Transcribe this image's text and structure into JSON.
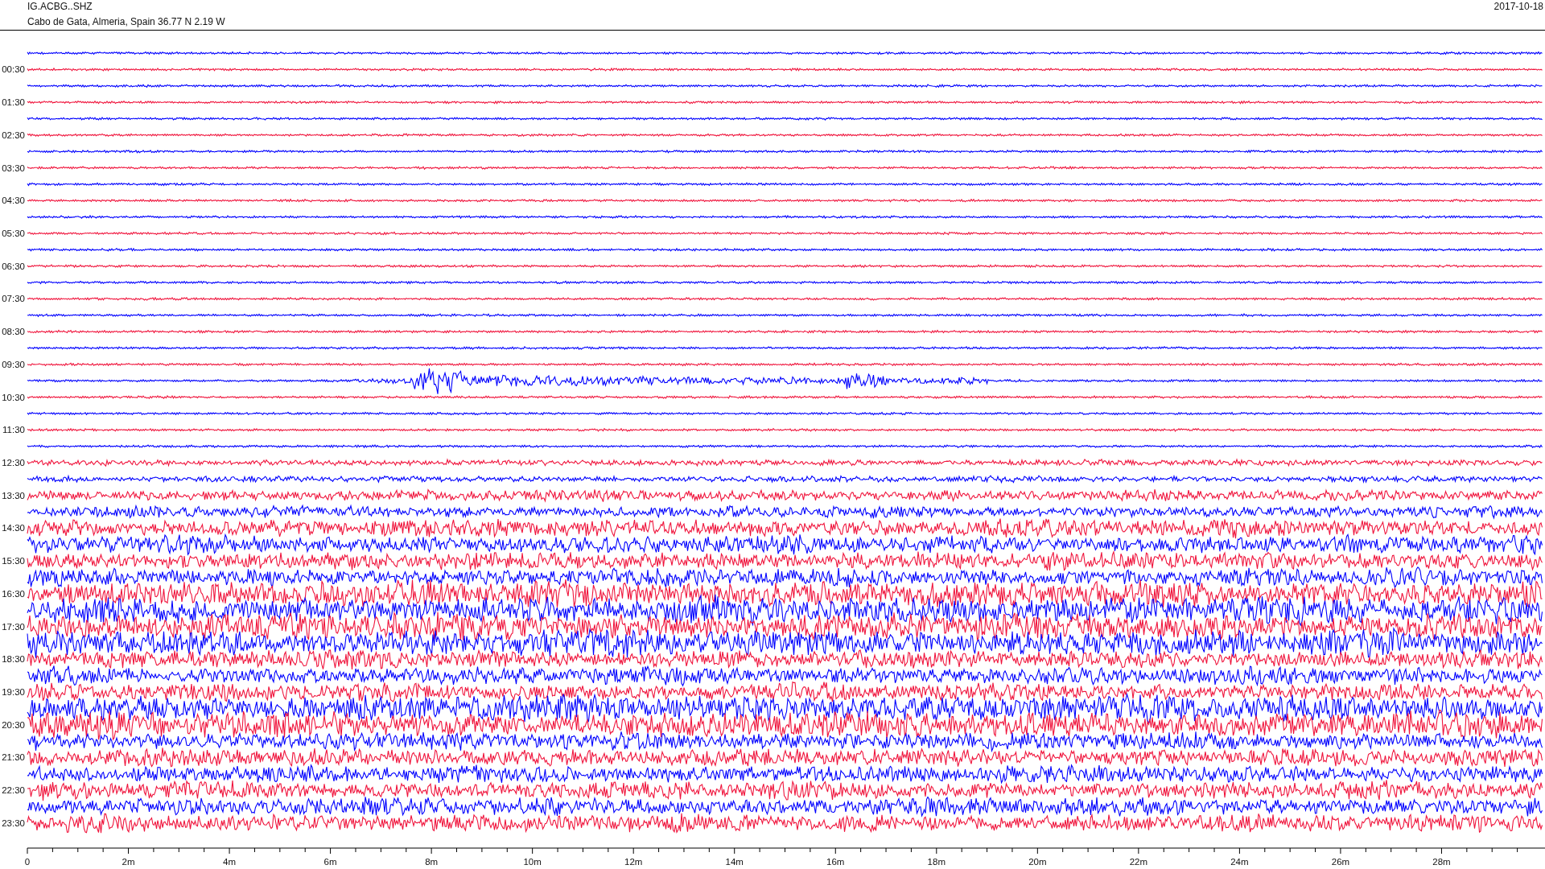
{
  "header": {
    "station": "IG.ACBG..SHZ",
    "location": "Cabo de Gata, Almeria, Spain  36.77 N 2.19 W",
    "date": "2017-10-18"
  },
  "traces": [
    {
      "color": "#0000ff",
      "kind": "quiet"
    },
    {
      "color": "#f0143c",
      "kind": "quiet",
      "label": "00:30"
    },
    {
      "color": "#0000ff",
      "kind": "quiet"
    },
    {
      "color": "#f0143c",
      "kind": "quiet",
      "label": "01:30"
    },
    {
      "color": "#0000ff",
      "kind": "quiet"
    },
    {
      "color": "#f0143c",
      "kind": "quiet",
      "label": "02:30"
    },
    {
      "color": "#0000ff",
      "kind": "quiet"
    },
    {
      "color": "#f0143c",
      "kind": "quiet",
      "label": "03:30"
    },
    {
      "color": "#0000ff",
      "kind": "quiet"
    },
    {
      "color": "#f0143c",
      "kind": "quiet",
      "label": "04:30"
    },
    {
      "color": "#0000ff",
      "kind": "quiet"
    },
    {
      "color": "#f0143c",
      "kind": "quiet",
      "label": "05:30"
    },
    {
      "color": "#0000ff",
      "kind": "quiet"
    },
    {
      "color": "#f0143c",
      "kind": "quiet",
      "label": "06:30"
    },
    {
      "color": "#0000ff",
      "kind": "quiet"
    },
    {
      "color": "#f0143c",
      "kind": "quiet",
      "label": "07:30"
    },
    {
      "color": "#0000ff",
      "kind": "quiet"
    },
    {
      "color": "#f0143c",
      "kind": "quiet",
      "label": "08:30"
    },
    {
      "color": "#0000ff",
      "kind": "quiet"
    },
    {
      "color": "#f0143c",
      "kind": "quiet",
      "label": "09:30"
    },
    {
      "color": "#0000ff",
      "kind": "event"
    },
    {
      "color": "#f0143c",
      "kind": "quiet",
      "label": "10:30"
    },
    {
      "color": "#0000ff",
      "kind": "quiet"
    },
    {
      "color": "#f0143c",
      "kind": "quiet",
      "label": "11:30"
    },
    {
      "color": "#0000ff",
      "kind": "quiet"
    },
    {
      "color": "#f0143c",
      "kind": "light",
      "label": "12:30"
    },
    {
      "color": "#0000ff",
      "kind": "light"
    },
    {
      "color": "#f0143c",
      "kind": "moderate",
      "label": "13:30"
    },
    {
      "color": "#0000ff",
      "kind": "moderate"
    },
    {
      "color": "#f0143c",
      "kind": "strong",
      "label": "14:30"
    },
    {
      "color": "#0000ff",
      "kind": "strong"
    },
    {
      "color": "#f0143c",
      "kind": "strong",
      "label": "15:30"
    },
    {
      "color": "#0000ff",
      "kind": "strong"
    },
    {
      "color": "#f0143c",
      "kind": "intense",
      "label": "16:30"
    },
    {
      "color": "#0000ff",
      "kind": "intense"
    },
    {
      "color": "#f0143c",
      "kind": "intense",
      "label": "17:30"
    },
    {
      "color": "#0000ff",
      "kind": "intense"
    },
    {
      "color": "#f0143c",
      "kind": "strong",
      "label": "18:30"
    },
    {
      "color": "#0000ff",
      "kind": "strong"
    },
    {
      "color": "#f0143c",
      "kind": "strong",
      "label": "19:30"
    },
    {
      "color": "#0000ff",
      "kind": "intense"
    },
    {
      "color": "#f0143c",
      "kind": "intense",
      "label": "20:30"
    },
    {
      "color": "#0000ff",
      "kind": "strong"
    },
    {
      "color": "#f0143c",
      "kind": "strong",
      "label": "21:30"
    },
    {
      "color": "#0000ff",
      "kind": "strong"
    },
    {
      "color": "#f0143c",
      "kind": "strong",
      "label": "22:30"
    },
    {
      "color": "#0000ff",
      "kind": "strong"
    },
    {
      "color": "#f0143c",
      "kind": "strong",
      "label": "23:30"
    }
  ],
  "x_axis": {
    "ticks": [
      "0",
      "2m",
      "4m",
      "6m",
      "8m",
      "10m",
      "12m",
      "14m",
      "16m",
      "18m",
      "20m",
      "22m",
      "24m",
      "26m",
      "28m"
    ]
  }
}
